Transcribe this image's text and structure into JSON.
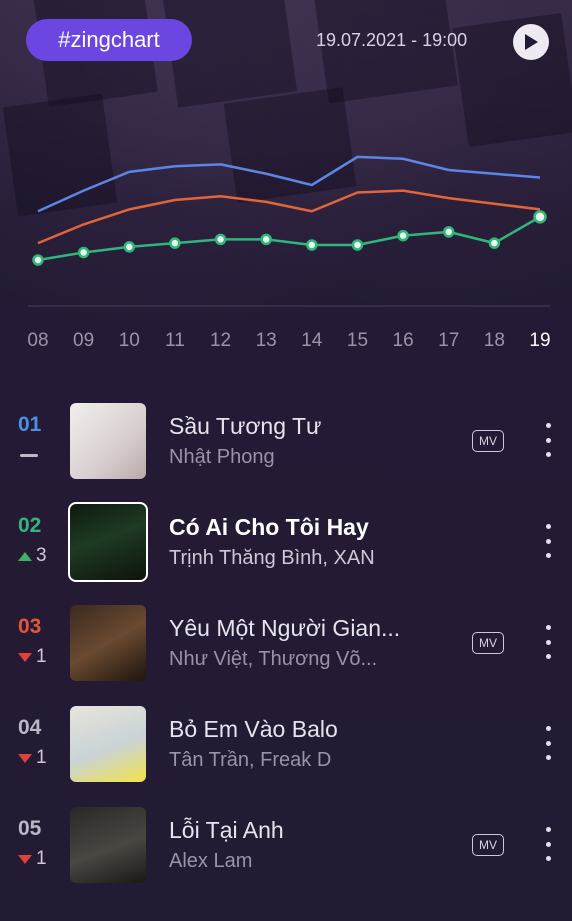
{
  "header": {
    "brand": "#zingchart",
    "timestamp": "19.07.2021 - 19:00",
    "play_icon": "play-icon"
  },
  "chart_data": {
    "type": "line",
    "x": [
      "08",
      "09",
      "10",
      "11",
      "12",
      "13",
      "14",
      "15",
      "16",
      "17",
      "18",
      "19"
    ],
    "highlighted_x": "19",
    "series": [
      {
        "color": "#5b86e5",
        "values": [
          62,
          73,
          83,
          86,
          87,
          82,
          76,
          91,
          90,
          84,
          82,
          80
        ]
      },
      {
        "color": "#e0653a",
        "values": [
          45,
          55,
          63,
          68,
          70,
          67,
          62,
          72,
          73,
          69,
          66,
          63
        ]
      },
      {
        "color": "#2fb77a",
        "values": [
          36,
          40,
          43,
          45,
          47,
          47,
          44,
          44,
          49,
          51,
          45,
          59
        ]
      }
    ],
    "ylim": [
      20,
      100
    ],
    "grid": false
  },
  "songs": [
    {
      "rank": "01",
      "rank_color": "#4a90e2",
      "trend": "none",
      "trend_value": "",
      "title": "Sầu Tương Tư",
      "artist": "Nhật Phong",
      "mv": "MV",
      "has_mv": true,
      "selected": false
    },
    {
      "rank": "02",
      "rank_color": "#35b37a",
      "trend": "up",
      "trend_value": "3",
      "title": "Có Ai Cho Tôi Hay",
      "artist": "Trịnh Thăng Bình, XAN",
      "mv": "",
      "has_mv": false,
      "selected": true
    },
    {
      "rank": "03",
      "rank_color": "#e2553a",
      "trend": "down",
      "trend_value": "1",
      "title": "Yêu Một Người Gian...",
      "artist": "Như Việt, Thương Võ...",
      "mv": "MV",
      "has_mv": true,
      "selected": false
    },
    {
      "rank": "04",
      "rank_color": "#bdb6c8",
      "trend": "down",
      "trend_value": "1",
      "title": "Bỏ Em Vào Balo",
      "artist": "Tân Trần, Freak D",
      "mv": "",
      "has_mv": false,
      "selected": false
    },
    {
      "rank": "05",
      "rank_color": "#bdb6c8",
      "trend": "down",
      "trend_value": "1",
      "title": "Lỗi Tại Anh",
      "artist": "Alex Lam",
      "mv": "MV",
      "has_mv": true,
      "selected": false
    }
  ]
}
